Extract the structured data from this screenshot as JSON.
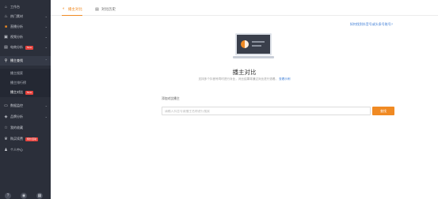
{
  "sidebar": {
    "items": [
      {
        "label": "工作台",
        "icon": "home-icon",
        "chevron": false
      },
      {
        "label": "热门素材",
        "icon": "fire-icon",
        "chevron": true
      },
      {
        "label": "直播分析",
        "icon": "live-icon",
        "chevron": true
      },
      {
        "label": "视频分析",
        "icon": "video-icon",
        "chevron": true
      },
      {
        "label": "电商分析",
        "icon": "cart-icon",
        "chevron": true,
        "badge": "New"
      },
      {
        "label": "播主查找",
        "icon": "search-icon",
        "chevron": true,
        "active": true
      }
    ],
    "subitems": [
      {
        "label": "播主搜索"
      },
      {
        "label": "播主排行榜"
      },
      {
        "label": "播主对比",
        "badge": "New",
        "current": true
      }
    ],
    "items2": [
      {
        "label": "数据监控",
        "icon": "monitor-icon",
        "chevron": true
      },
      {
        "label": "品牌分析",
        "icon": "brand-icon",
        "chevron": true
      },
      {
        "label": "我的收藏",
        "icon": "star-icon",
        "chevron": false
      },
      {
        "label": "购买续费",
        "icon": "crown-icon",
        "chevron": false,
        "badge": "特价活动"
      },
      {
        "label": "个人中心",
        "icon": "user-icon",
        "chevron": false
      }
    ]
  },
  "tabs": [
    {
      "label": "播主对比",
      "icon": "compare-icon",
      "active": true
    },
    {
      "label": "对比历史",
      "icon": "history-icon",
      "active": false
    }
  ],
  "help_link": "如何找到抖音号或头条号账号?",
  "title": "播主对比",
  "description": "支持多个抖音号同时进行对比，对比结果将通过对比进行查看。",
  "description_link": "查看示例",
  "search": {
    "label": "添加对比播主",
    "placeholder": "请输入抖音号或播主名称进行搜索",
    "button": "查找"
  },
  "colors": {
    "accent": "#f08a23",
    "sidebar": "#2b2f3a",
    "link": "#3a7bd5",
    "badge": "#e8423c"
  }
}
